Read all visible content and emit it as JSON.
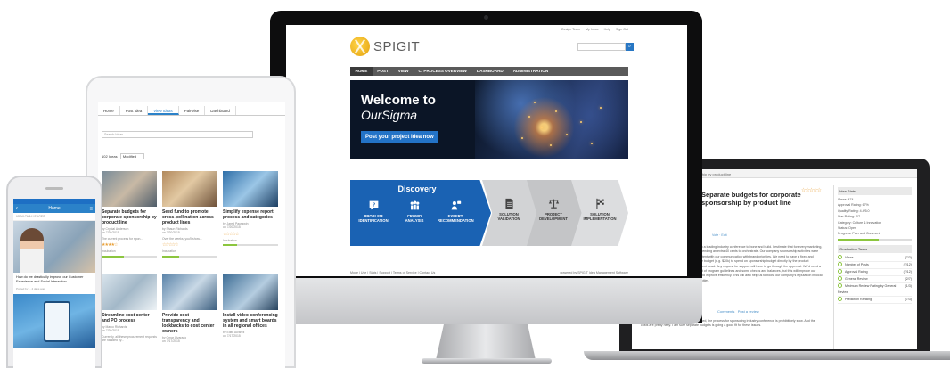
{
  "imac": {
    "util_links": [
      "Design Team",
      "My Inbox",
      "Help",
      "Sign Out"
    ],
    "logo_text": "SPIGIT",
    "nav": [
      "HOME",
      "POST",
      "VIEW",
      "CI PROCESS OVERVIEW",
      "DASHBOARD",
      "ADMINISTRATION"
    ],
    "hero": {
      "line1": "Welcome to",
      "line2": "OurSigma",
      "button": "Post your project idea now"
    },
    "process": {
      "title": "Discovery",
      "steps": [
        {
          "label": "PROBLEM\nIDENTIFICATION",
          "icon": "question-bubble-icon"
        },
        {
          "label": "CROWD\nANALYSIS",
          "icon": "crowd-icon"
        },
        {
          "label": "EXPERT\nRECOMMENDATION",
          "icon": "expert-icon"
        },
        {
          "label": "SOLUTION\nVALIDATION",
          "icon": "document-icon"
        },
        {
          "label": "PROJECT\nDEVELOPMENT",
          "icon": "scale-icon"
        },
        {
          "label": "SOLUTION\nIMPLEMENTATION",
          "icon": "finish-flag-icon"
        }
      ]
    },
    "footer_left": "Mode | Use | Stats | Support | Terms of Service | Contact Us",
    "footer_right": "powered by SPIGIT Idea Management Software"
  },
  "tablet": {
    "tabs": [
      "Home",
      "Post Idea",
      "View Ideas",
      "Pairwise",
      "Dashboard"
    ],
    "search_placeholder": "Search Ideas",
    "filter_count": "102 Ideas",
    "filter_sort": "Modified",
    "cards": [
      {
        "title": "Separate budgets for corporate sponsorship by product line",
        "meta": "by Crystal Anderson\non 7/20/2015",
        "excerpt": "The current process for spon..."
      },
      {
        "title": "Seed fund to promote cross-pollination across product lines",
        "meta": "by Shaun Richards\non 7/20/2015",
        "excerpt": "Over the weeks, you'll show..."
      },
      {
        "title": "Simplify expense report process and categories",
        "meta": "by Jared Pausswin\non 7/20/2015",
        "excerpt": ""
      },
      {
        "title": "Streamline cost center and PO process",
        "meta": "by Marco Richards\non 7/20/2015",
        "excerpt": "Currently, all these procurement requests are handled by..."
      },
      {
        "title": "Provide cost transparency and lockbacks to cost center owners",
        "meta": "by Omar Alvarado\non 7/17/2015",
        "excerpt": ""
      },
      {
        "title": "Install video conferencing system and smart boards in all regional offices",
        "meta": "by Edith Alvarez\non 7/17/2015",
        "excerpt": ""
      }
    ],
    "incubation": "Incubation"
  },
  "laptop": {
    "breadcrumb": "Separate budgets for corporate sponsorship by product line",
    "title": "Separate budgets for corporate sponsorship by product line",
    "body": "I went to a leading industry conference to bone and build. I estimate that for every marketing, we're spending an extra 40 cents to orchestrate. Our company sponsorship activities were inconsistent with our communication with brand priorities. We need to have a fixed and separate budget (e.g. $20k) to spend on sponsorship budget directly by the product department head. Any request for support will have to go through the approval. We'd need a good set of program guidelines and some checks and balances, but this will improve our reach and improve efficiency. This will also help us to boost our company's reputation in local communities.",
    "links": [
      "Vote",
      "Edit"
    ],
    "comment_tabs": [
      "Comments",
      "Post a review"
    ],
    "comment": "This is a great idea. Overall do you mentioned, the process for sponsoring industry conference is prohibitively slow. And the costs are pretty hefty. I am sure separate budgets is going a good fit for these issues.",
    "side": {
      "header": "Idea Stats",
      "lines": [
        "Views: 474",
        "Approval Rating: 67%",
        "Quality Rating: 4.4/5.0",
        "Star Rating: 4/7",
        "Category: Culture & Innovation",
        "Status: Open",
        "Progress: Peer and Comment"
      ],
      "tasks_header": "Graduation Tasks",
      "tasks": [
        {
          "label": "Views",
          "value": "(7/3)"
        },
        {
          "label": "Number of Posts",
          "value": "(7/12)"
        },
        {
          "label": "Approval Rating",
          "value": "(7/12)"
        },
        {
          "label": "General Review",
          "value": "(2/7)"
        },
        {
          "label": "Minimum Review Rating by General Review",
          "value": "(1/3)"
        },
        {
          "label": "Prediction Ranking",
          "value": "(7/3)"
        }
      ],
      "progress_pct": 55
    }
  },
  "phone": {
    "title": "Home",
    "sub": "VIEW CHALLENGES",
    "post1": "How do we drastically improve our Customer Experience and Social Interaction",
    "post1_meta": "Posted by ... 4 days ago",
    "post2_meta": ""
  },
  "colors": {
    "brand_blue": "#2373c7",
    "discovery_blue": "#1a62b3",
    "nav_gray": "#5a5a5a",
    "star": "#e8a13a",
    "progress_green": "#8cc63f"
  }
}
